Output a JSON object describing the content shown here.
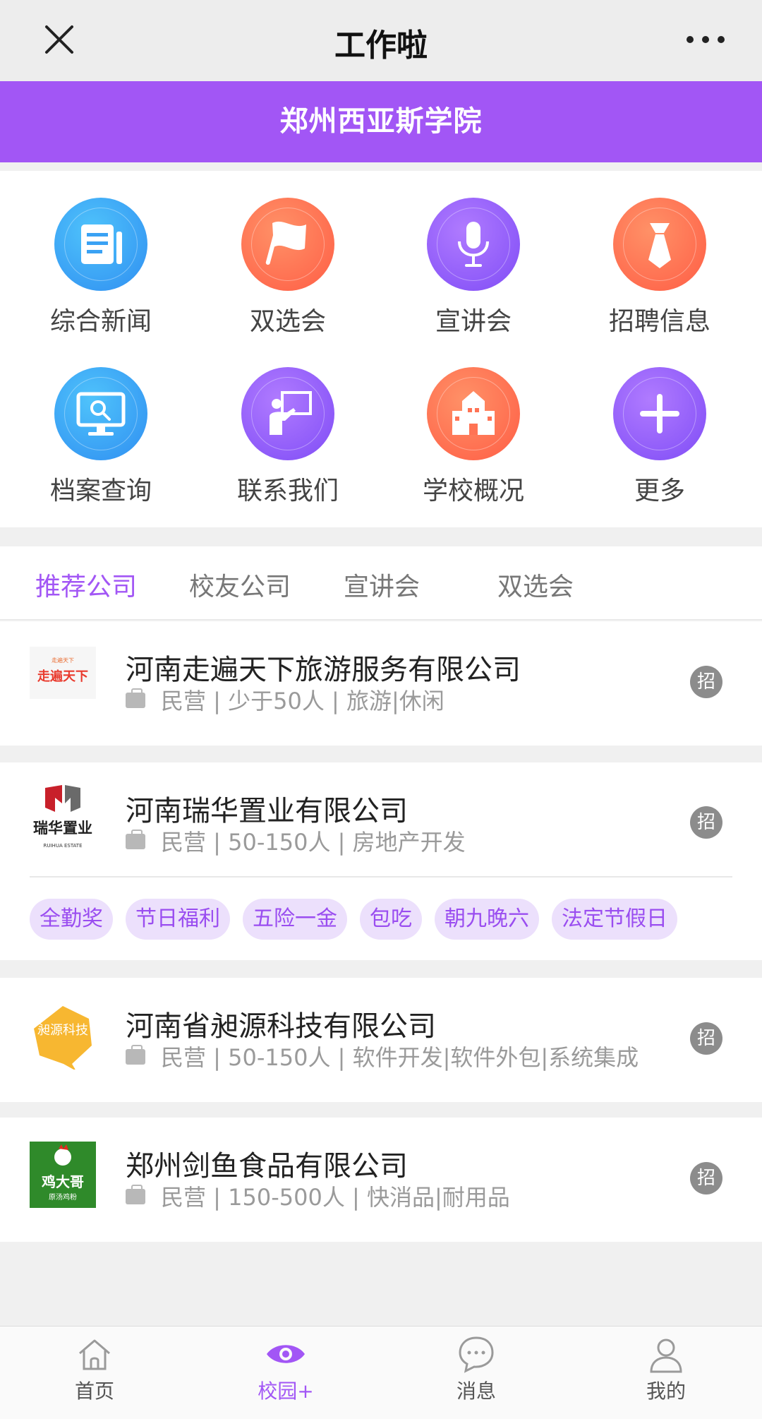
{
  "nav": {
    "title": "工作啦"
  },
  "school": {
    "name": "郑州西亚斯学院"
  },
  "menu": [
    {
      "label": "综合新闻",
      "icon": "news-icon",
      "color": "blue"
    },
    {
      "label": "双选会",
      "icon": "flag-icon",
      "color": "orange"
    },
    {
      "label": "宣讲会",
      "icon": "microphone-icon",
      "color": "purple"
    },
    {
      "label": "招聘信息",
      "icon": "tie-icon",
      "color": "orange"
    },
    {
      "label": "档案查询",
      "icon": "monitor-search-icon",
      "color": "blue"
    },
    {
      "label": "联系我们",
      "icon": "teacher-board-icon",
      "color": "purple"
    },
    {
      "label": "学校概况",
      "icon": "school-building-icon",
      "color": "orange"
    },
    {
      "label": "更多",
      "icon": "plus-icon",
      "color": "purple"
    }
  ],
  "tabs": [
    {
      "label": "推荐公司",
      "active": true
    },
    {
      "label": "校友公司",
      "active": false
    },
    {
      "label": "宣讲会",
      "active": false
    },
    {
      "label": "双选会",
      "active": false
    }
  ],
  "companies": [
    {
      "name": "河南走遍天下旅游服务有限公司",
      "info": "民营 | 少于50人 | 旅游|休闲",
      "badge": "招",
      "logo_text": "走遍天下",
      "logo_subtext": "走遍天下"
    },
    {
      "name": "河南瑞华置业有限公司",
      "info": "民营 | 50-150人 | 房地产开发",
      "badge": "招",
      "logo_text": "瑞华置业",
      "logo_subtext": "RUIHUA ESTATE",
      "tags": [
        "全勤奖",
        "节日福利",
        "五险一金",
        "包吃",
        "朝九晚六",
        "法定节假日"
      ]
    },
    {
      "name": "河南省昶源科技有限公司",
      "info": "民营 | 50-150人 | 软件开发|软件外包|系统集成",
      "badge": "招",
      "logo_text": "昶源科技"
    },
    {
      "name": "郑州剑鱼食品有限公司",
      "info": "民营 | 150-500人 | 快消品|耐用品",
      "badge": "招",
      "logo_text": "鸡大哥",
      "logo_subtext": "原汤鸡粉"
    }
  ],
  "bottom_tabs": [
    {
      "label": "首页",
      "icon": "home-icon",
      "active": false
    },
    {
      "label": "校园+",
      "icon": "eye-icon",
      "active": true
    },
    {
      "label": "消息",
      "icon": "chat-icon",
      "active": false
    },
    {
      "label": "我的",
      "icon": "user-icon",
      "active": false
    }
  ],
  "colors": {
    "accent": "#a256f5",
    "blue": "#2f8ef1",
    "orange": "#ff5d45",
    "purple": "#7f4cf6"
  }
}
